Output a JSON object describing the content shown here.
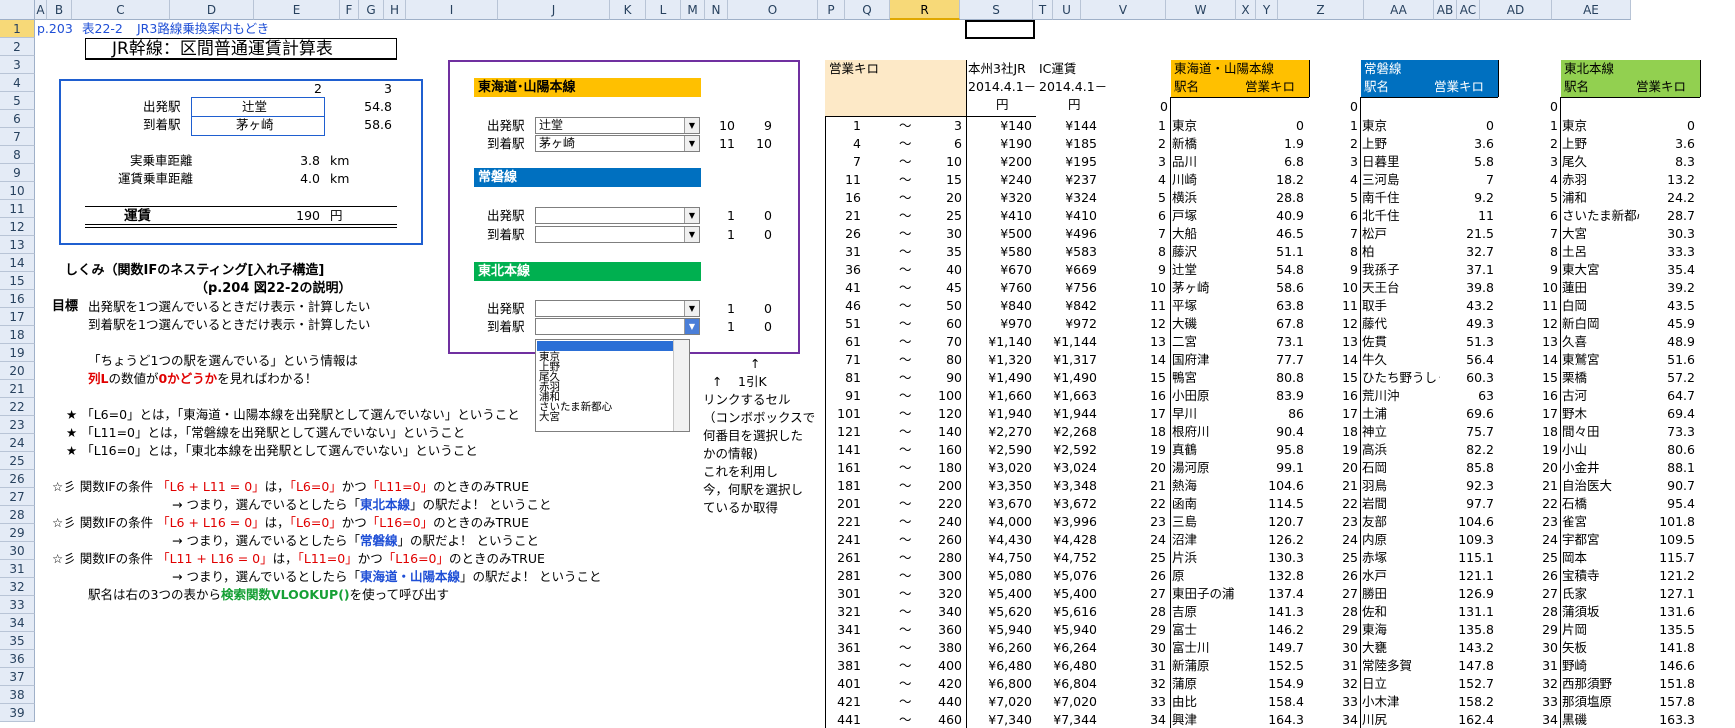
{
  "sheet": {
    "columns": [
      "A",
      "B",
      "C",
      "D",
      "E",
      "F",
      "G",
      "H",
      "I",
      "J",
      "K",
      "L",
      "M",
      "N",
      "O",
      "P",
      "Q",
      "R",
      "S",
      "T",
      "U",
      "V",
      "W",
      "X",
      "Y",
      "Z",
      "AA",
      "AB",
      "AC",
      "AD",
      "AE"
    ],
    "rows": [
      "1",
      "2",
      "3",
      "4",
      "5",
      "6",
      "7",
      "8",
      "9",
      "10",
      "11",
      "12",
      "13",
      "14",
      "15",
      "16",
      "17",
      "18",
      "19",
      "20",
      "21",
      "22",
      "23",
      "24",
      "25",
      "26",
      "27",
      "28",
      "29",
      "30",
      "31",
      "32",
      "33",
      "34",
      "35",
      "36",
      "37",
      "38",
      "39"
    ],
    "selected_col": "R",
    "selected_row": "1"
  },
  "header": {
    "ref": "p.203",
    "table": "表22-2",
    "desc": "JR3路線乗換案内もどき",
    "title": "JR幹線：区間普通運賃計算表"
  },
  "calc": {
    "col2": "2",
    "col3": "3",
    "from_label": "出発駅",
    "from_station": "辻堂",
    "from_km": "54.8",
    "to_label": "到着駅",
    "to_station": "茅ヶ崎",
    "to_km": "58.6",
    "real_label": "実乗車距離",
    "real_val": "3.8",
    "real_unit": "km",
    "fare_dist_label": "運賃乗車距離",
    "fare_dist_val": "4.0",
    "fare_dist_unit": "km",
    "fare_label": "運賃",
    "fare_val": "190",
    "fare_unit": "円"
  },
  "explain": {
    "h1": "しくみ（関数IFのネスティング[入れ子構造]",
    "h2": "（p.204  図22-2の説明）",
    "goal_label": "目標",
    "goal1": "出発駅を1つ選んでいるときだけ表示・計算したい",
    "goal2": "到着駅を1つ選んでいるときだけ表示・計算したい",
    "info1": "「ちょうど1つの駅を選んでいる」という情報は",
    "info2a": "列L",
    "info2b": "の数値が",
    "info2c": "0かどうか",
    "info2d": "を見ればわかる！",
    "star": "★",
    "s1a": "「L6=0」とは，「東海道・山陽本線を出発駅として選んでいない」ということ",
    "s2a": "「L11=0」とは，「常磐線を出発駅として選んでいない」ということ",
    "s3a": "「L16=0」とは，「東北本線を出発駅として選んでいない」ということ",
    "m": "☆彡",
    "if_label": "関数IFの条件",
    "c1": "「L6 + L11 = 0」",
    "c1b": "は，",
    "c1c": "「L6=0」",
    "c1d": "かつ",
    "c1e": "「L11=0」",
    "c1f": "のときのみTRUE",
    "c1g": "→ つまり，選んでいるとしたら「",
    "c1h": "東北本線",
    "c1i": "」の駅だよ！  ということ",
    "c2": "「L6 + L16 = 0」",
    "c2c": "「L6=0」",
    "c2e": "「L16=0」",
    "c2h": "常磐線",
    "c3": "「L11 + L16 = 0」",
    "c3c": "「L11=0」",
    "c3e": "「L16=0」",
    "c3h": "東海道・山陽本線",
    "last1": "駅名は右の3つの表から",
    "last2": "検索関数VLOOKUP()",
    "last3": "を使って呼び出す"
  },
  "panel": {
    "tokaido": "東海道･山陽本線",
    "joban": "常磐線",
    "tohoku": "東北本線",
    "from_label": "出発駅",
    "to_label": "到着駅",
    "t_from": "辻堂",
    "t_to": "茅ヶ崎",
    "t_k_from": "10",
    "t_l_from": "9",
    "t_k_to": "11",
    "t_l_to": "10",
    "j_k_from": "1",
    "j_l_from": "0",
    "j_k_to": "1",
    "j_l_to": "0",
    "h_k_from": "1",
    "h_l_from": "0",
    "h_k_to": "1",
    "h_l_to": "0",
    "dropdown": [
      "東京",
      "上野",
      "尾久",
      "赤羽",
      "浦和",
      "さいたま新都心",
      "大宮"
    ],
    "arrow_up": "↑",
    "arrow_up2": "↑",
    "idx_label": "1引K",
    "note": [
      "リンクするセル",
      "（コンボボックスで",
      "何番目を選択した",
      "かの情報)",
      "これを利用し",
      "今，何駅を選択し",
      "ているか取得"
    ]
  },
  "fare": {
    "h1": "営業キロ",
    "h2": "本州3社JR",
    "h3": "IC運賃",
    "h4": "2014.4.1－",
    "h5": "2014.4.1－",
    "h6": "円",
    "h7": "円",
    "tilde": "〜",
    "rows": [
      [
        "1",
        "3",
        "¥140",
        "¥144"
      ],
      [
        "4",
        "6",
        "¥190",
        "¥185"
      ],
      [
        "7",
        "10",
        "¥200",
        "¥195"
      ],
      [
        "11",
        "15",
        "¥240",
        "¥237"
      ],
      [
        "16",
        "20",
        "¥320",
        "¥324"
      ],
      [
        "21",
        "25",
        "¥410",
        "¥410"
      ],
      [
        "26",
        "30",
        "¥500",
        "¥496"
      ],
      [
        "31",
        "35",
        "¥580",
        "¥583"
      ],
      [
        "36",
        "40",
        "¥670",
        "¥669"
      ],
      [
        "41",
        "45",
        "¥760",
        "¥756"
      ],
      [
        "46",
        "50",
        "¥840",
        "¥842"
      ],
      [
        "51",
        "60",
        "¥970",
        "¥972"
      ],
      [
        "61",
        "70",
        "¥1,140",
        "¥1,144"
      ],
      [
        "71",
        "80",
        "¥1,320",
        "¥1,317"
      ],
      [
        "81",
        "90",
        "¥1,490",
        "¥1,490"
      ],
      [
        "91",
        "100",
        "¥1,660",
        "¥1,663"
      ],
      [
        "101",
        "120",
        "¥1,940",
        "¥1,944"
      ],
      [
        "121",
        "140",
        "¥2,270",
        "¥2,268"
      ],
      [
        "141",
        "160",
        "¥2,590",
        "¥2,592"
      ],
      [
        "161",
        "180",
        "¥3,020",
        "¥3,024"
      ],
      [
        "181",
        "200",
        "¥3,350",
        "¥3,348"
      ],
      [
        "201",
        "220",
        "¥3,670",
        "¥3,672"
      ],
      [
        "221",
        "240",
        "¥4,000",
        "¥3,996"
      ],
      [
        "241",
        "260",
        "¥4,430",
        "¥4,428"
      ],
      [
        "261",
        "280",
        "¥4,750",
        "¥4,752"
      ],
      [
        "281",
        "300",
        "¥5,080",
        "¥5,076"
      ],
      [
        "301",
        "320",
        "¥5,400",
        "¥5,400"
      ],
      [
        "321",
        "340",
        "¥5,620",
        "¥5,616"
      ],
      [
        "341",
        "360",
        "¥5,940",
        "¥5,940"
      ],
      [
        "361",
        "380",
        "¥6,260",
        "¥6,264"
      ],
      [
        "381",
        "400",
        "¥6,480",
        "¥6,480"
      ],
      [
        "401",
        "420",
        "¥6,800",
        "¥6,804"
      ],
      [
        "421",
        "440",
        "¥7,020",
        "¥7,020"
      ],
      [
        "441",
        "460",
        "¥7,340",
        "¥7,344"
      ]
    ]
  },
  "tokaido_table": {
    "title": "東海道・山陽本線",
    "h1": "駅名",
    "h2": "営業キロ",
    "zero": "0",
    "rows": [
      [
        "1",
        "東京",
        "0"
      ],
      [
        "2",
        "新橋",
        "1.9"
      ],
      [
        "3",
        "品川",
        "6.8"
      ],
      [
        "4",
        "川崎",
        "18.2"
      ],
      [
        "5",
        "横浜",
        "28.8"
      ],
      [
        "6",
        "戸塚",
        "40.9"
      ],
      [
        "7",
        "大船",
        "46.5"
      ],
      [
        "8",
        "藤沢",
        "51.1"
      ],
      [
        "9",
        "辻堂",
        "54.8"
      ],
      [
        "10",
        "茅ヶ崎",
        "58.6"
      ],
      [
        "11",
        "平塚",
        "63.8"
      ],
      [
        "12",
        "大磯",
        "67.8"
      ],
      [
        "13",
        "二宮",
        "73.1"
      ],
      [
        "14",
        "国府津",
        "77.7"
      ],
      [
        "15",
        "鴨宮",
        "80.8"
      ],
      [
        "16",
        "小田原",
        "83.9"
      ],
      [
        "17",
        "早川",
        "86"
      ],
      [
        "18",
        "根府川",
        "90.4"
      ],
      [
        "19",
        "真鶴",
        "95.8"
      ],
      [
        "20",
        "湯河原",
        "99.1"
      ],
      [
        "21",
        "熱海",
        "104.6"
      ],
      [
        "22",
        "函南",
        "114.5"
      ],
      [
        "23",
        "三島",
        "120.7"
      ],
      [
        "24",
        "沼津",
        "126.2"
      ],
      [
        "25",
        "片浜",
        "130.3"
      ],
      [
        "26",
        "原",
        "132.8"
      ],
      [
        "27",
        "東田子の浦",
        "137.4"
      ],
      [
        "28",
        "吉原",
        "141.3"
      ],
      [
        "29",
        "富士",
        "146.2"
      ],
      [
        "30",
        "富士川",
        "149.7"
      ],
      [
        "31",
        "新蒲原",
        "152.5"
      ],
      [
        "32",
        "蒲原",
        "154.9"
      ],
      [
        "33",
        "由比",
        "158.4"
      ],
      [
        "34",
        "興津",
        "164.3"
      ]
    ]
  },
  "joban_table": {
    "title": "常磐線",
    "h1": "駅名",
    "h2": "営業キロ",
    "zero": "0",
    "rows": [
      [
        "1",
        "東京",
        "0"
      ],
      [
        "2",
        "上野",
        "3.6"
      ],
      [
        "3",
        "日暮里",
        "5.8"
      ],
      [
        "4",
        "三河島",
        "7"
      ],
      [
        "5",
        "南千住",
        "9.2"
      ],
      [
        "6",
        "北千住",
        "11"
      ],
      [
        "7",
        "松戸",
        "21.5"
      ],
      [
        "8",
        "柏",
        "32.7"
      ],
      [
        "9",
        "我孫子",
        "37.1"
      ],
      [
        "10",
        "天王台",
        "39.8"
      ],
      [
        "11",
        "取手",
        "43.2"
      ],
      [
        "12",
        "藤代",
        "49.3"
      ],
      [
        "13",
        "佐貫",
        "51.3"
      ],
      [
        "14",
        "牛久",
        "56.4"
      ],
      [
        "15",
        "ひたち野うしく",
        "60.3"
      ],
      [
        "16",
        "荒川沖",
        "63"
      ],
      [
        "17",
        "土浦",
        "69.6"
      ],
      [
        "18",
        "神立",
        "75.7"
      ],
      [
        "19",
        "高浜",
        "82.2"
      ],
      [
        "20",
        "石岡",
        "85.8"
      ],
      [
        "21",
        "羽鳥",
        "92.3"
      ],
      [
        "22",
        "岩間",
        "97.7"
      ],
      [
        "23",
        "友部",
        "104.6"
      ],
      [
        "24",
        "内原",
        "109.3"
      ],
      [
        "25",
        "赤塚",
        "115.1"
      ],
      [
        "26",
        "水戸",
        "121.1"
      ],
      [
        "27",
        "勝田",
        "126.9"
      ],
      [
        "28",
        "佐和",
        "131.1"
      ],
      [
        "29",
        "東海",
        "135.8"
      ],
      [
        "30",
        "大甕",
        "143.2"
      ],
      [
        "31",
        "常陸多賀",
        "147.8"
      ],
      [
        "32",
        "日立",
        "152.7"
      ],
      [
        "33",
        "小木津",
        "158.2"
      ],
      [
        "34",
        "川尻",
        "162.4"
      ]
    ]
  },
  "tohoku_table": {
    "title": "東北本線",
    "h1": "駅名",
    "h2": "営業キロ",
    "zero": "0",
    "rows": [
      [
        "1",
        "東京",
        "0"
      ],
      [
        "2",
        "上野",
        "3.6"
      ],
      [
        "3",
        "尾久",
        "8.3"
      ],
      [
        "4",
        "赤羽",
        "13.2"
      ],
      [
        "5",
        "浦和",
        "24.2"
      ],
      [
        "6",
        "さいたま新都心",
        "28.7"
      ],
      [
        "7",
        "大宮",
        "30.3"
      ],
      [
        "8",
        "土呂",
        "33.3"
      ],
      [
        "9",
        "東大宮",
        "35.4"
      ],
      [
        "10",
        "蓮田",
        "39.2"
      ],
      [
        "11",
        "白岡",
        "43.5"
      ],
      [
        "12",
        "新白岡",
        "45.9"
      ],
      [
        "13",
        "久喜",
        "48.9"
      ],
      [
        "14",
        "東鷲宮",
        "51.6"
      ],
      [
        "15",
        "栗橋",
        "57.2"
      ],
      [
        "16",
        "古河",
        "64.7"
      ],
      [
        "17",
        "野木",
        "69.4"
      ],
      [
        "18",
        "間々田",
        "73.3"
      ],
      [
        "19",
        "小山",
        "80.6"
      ],
      [
        "20",
        "小金井",
        "88.1"
      ],
      [
        "21",
        "自治医大",
        "90.7"
      ],
      [
        "22",
        "石橋",
        "95.4"
      ],
      [
        "23",
        "雀宮",
        "101.8"
      ],
      [
        "24",
        "宇都宮",
        "109.5"
      ],
      [
        "25",
        "岡本",
        "115.7"
      ],
      [
        "26",
        "宝積寺",
        "121.2"
      ],
      [
        "27",
        "氏家",
        "127.1"
      ],
      [
        "28",
        "蒲須坂",
        "131.6"
      ],
      [
        "29",
        "片岡",
        "135.5"
      ],
      [
        "30",
        "矢板",
        "141.8"
      ],
      [
        "31",
        "野崎",
        "146.6"
      ],
      [
        "32",
        "西那須野",
        "151.8"
      ],
      [
        "33",
        "那須塩原",
        "157.8"
      ],
      [
        "34",
        "黒磯",
        "163.3"
      ]
    ]
  }
}
